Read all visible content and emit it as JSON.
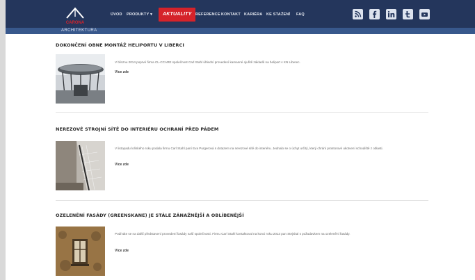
{
  "brand": {
    "logo_text": "CARONA",
    "tagline": "ARCHITEKTURA",
    "accent": "#d5232a",
    "nav_bg": "#24365c",
    "subbar_bg": "#38588c"
  },
  "nav": {
    "items": [
      {
        "label": "ÚVOD"
      },
      {
        "label": "PRODUKTY ▾"
      },
      {
        "label": "AKTUALITY",
        "active": true
      },
      {
        "label": "REFERENCE"
      },
      {
        "label": "KONTAKT"
      },
      {
        "label": "KARIÉRA"
      },
      {
        "label": "KE STAŽENÍ"
      },
      {
        "label": "FAQ"
      }
    ]
  },
  "social": {
    "icons": [
      "rss-icon",
      "facebook-icon",
      "linkedin-icon",
      "twitter-icon",
      "youtube-icon"
    ]
  },
  "articles": [
    {
      "title": "DOKONČENÍ OBNE MONTÁŽ HELIPORTU V LIBERCI",
      "text": "V březnu 2014 poprvé firma CL-CCARE společnost Carl Stahl úhlední provedení kamanné ojuřitě základů na heliport v KN Liberec.",
      "more": "Více zde"
    },
    {
      "title": "NEREZOVÉ STROJNÍ SÍTĚ DO INTERIÉRU OCHRANÍ PŘED PÁDEM",
      "text": "V listopadu loňského roku podala firmu Carl Stahl paní Eva Purgerová s dotazem na nerezové sítě do interiéru. Jednalo se o úchyt určitý, který chrání prostorové ukotvení schodiště z oblasti.",
      "more": "Více zde"
    },
    {
      "title": "OZELENĚNÍ FASÁDY (GREENSKANE) JE STÁLE ZÁNAŽNĚJŠÍ A OBLÍBENĚJŠÍ",
      "text": "Podíváte se na další představení provedení fasády naší společnosti. Firmu Carl Stahl kontaktoval na konci roku 2013 pan Stejskal s požadavkem na ozelenění fasády.",
      "more": "Více zde"
    }
  ]
}
